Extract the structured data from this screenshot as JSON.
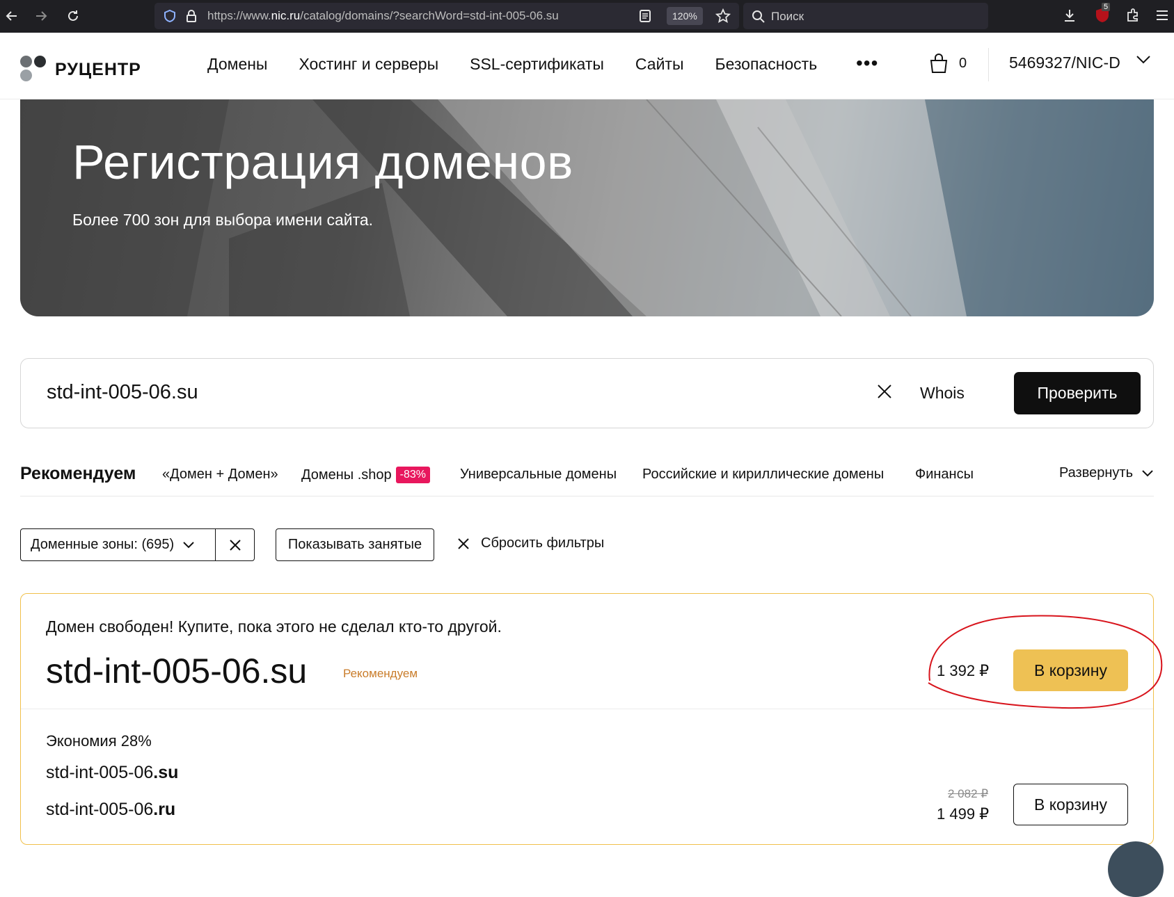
{
  "browser": {
    "url_prefix": "https://www.",
    "url_host": "nic.ru",
    "url_path": "/catalog/domains/?searchWord=std-int-005-06.su",
    "zoom": "120%",
    "search_placeholder": "Поиск",
    "extension_badge": "5"
  },
  "header": {
    "brand": "РУЦЕНТР",
    "menu": [
      "Домены",
      "Хостинг и серверы",
      "SSL-сертификаты",
      "Сайты",
      "Безопасность"
    ],
    "cart_count": "0",
    "account": "5469327/NIC-D"
  },
  "hero": {
    "title": "Регистрация доменов",
    "subtitle": "Более 700 зон для выбора имени сайта."
  },
  "search": {
    "value": "std-int-005-06.su",
    "whois_label": "Whois",
    "check_label": "Проверить"
  },
  "recommend": {
    "title": "Рекомендуем",
    "tabs": [
      "«Домен + Домен»",
      "Домены .shop",
      "Универсальные домены",
      "Российские и кириллические домены",
      "Финансы"
    ],
    "shop_badge": "-83%",
    "expand_label": "Развернуть"
  },
  "filters": {
    "zones_label": "Доменные зоны: (695)",
    "show_busy_label": "Показывать занятые",
    "reset_label": "Сбросить фильтры"
  },
  "result": {
    "free_message": "Домен свободен! Купите, пока этого не сделал кто-то другой.",
    "domain": "std-int-005-06.su",
    "recommended_tag": "Рекомендуем",
    "price": "1 392 ₽",
    "add_to_cart": "В корзину",
    "bundle": {
      "savings": "Экономия 28%",
      "items": [
        {
          "name": "std-int-005-06",
          "zone": ".su"
        },
        {
          "name": "std-int-005-06",
          "zone": ".ru"
        }
      ],
      "old_price": "2 082 ₽",
      "price": "1 499 ₽",
      "add_to_cart": "В корзину"
    }
  },
  "colors": {
    "accent_yellow": "#eec154",
    "badge_pink": "#e8175d",
    "annotation_red": "#d8141c",
    "recommend_orange": "#c97c2a"
  }
}
